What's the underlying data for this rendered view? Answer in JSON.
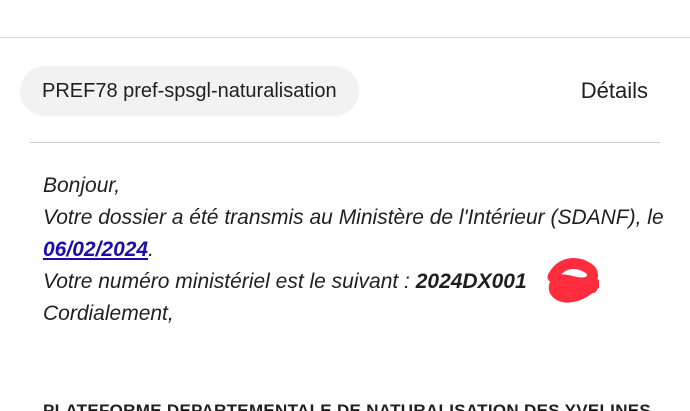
{
  "email": {
    "sender_label": "PREF78 pref-spsgl-naturalisation",
    "details_label": "Détails",
    "body": {
      "greeting": "Bonjour,",
      "line_transmitted_prefix": "Votre dossier a été transmis au Ministère de l'Intérieur (SDANF), le",
      "transmission_date": "06/02/2024",
      "date_suffix": ".",
      "ministry_number_prefix": "Votre numéro ministériel est le suivant :",
      "ministry_number_visible": "2024DX001",
      "ministry_number_suffix": ".",
      "closing": "Cordialement,"
    },
    "footer_heading": "PLATEFORME DEPARTEMENTALE DE NATURALISATION DES YVELINES"
  },
  "colors": {
    "link": "#1a0dab",
    "redaction": "#ff2d3d",
    "chip_background": "#f2f2f2"
  }
}
